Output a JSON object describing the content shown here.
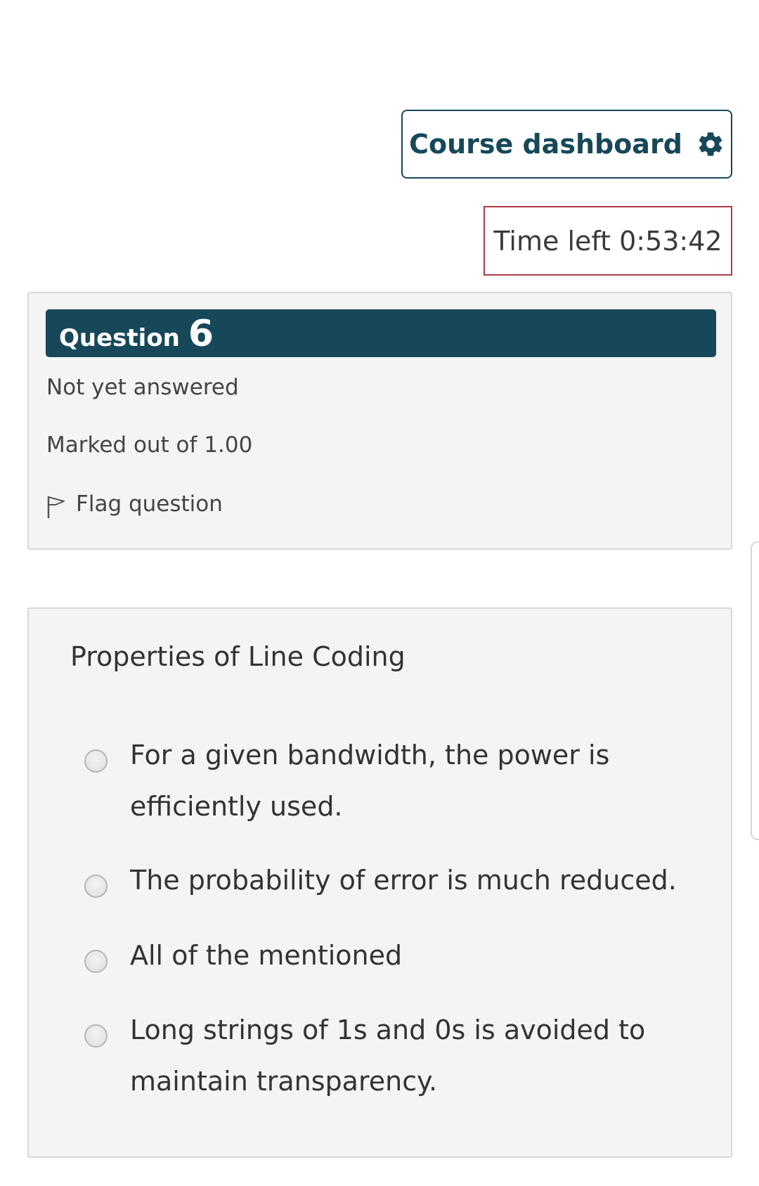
{
  "header": {
    "dashboard_label": "Course dashboard",
    "timer_text": "Time left 0:53:42"
  },
  "question_info": {
    "label": "Question",
    "number": "6",
    "status": "Not yet answered",
    "marks": "Marked out of 1.00",
    "flag_label": "Flag question"
  },
  "question": {
    "text": "Properties of Line Coding",
    "options": [
      {
        "label": "For a given bandwidth, the power is efficiently used.",
        "selected": false
      },
      {
        "label": "The probability of error is much reduced.",
        "selected": false
      },
      {
        "label": "All of the mentioned",
        "selected": false
      },
      {
        "label": "Long strings of 1s and 0s is avoided to maintain transparency.",
        "selected": false
      }
    ]
  },
  "colors": {
    "primary": "#164859",
    "timer_border": "#b0384a",
    "panel_bg": "#f4f4f4"
  },
  "icons": {
    "dashboard": "gear-icon",
    "flag": "flag-icon"
  }
}
